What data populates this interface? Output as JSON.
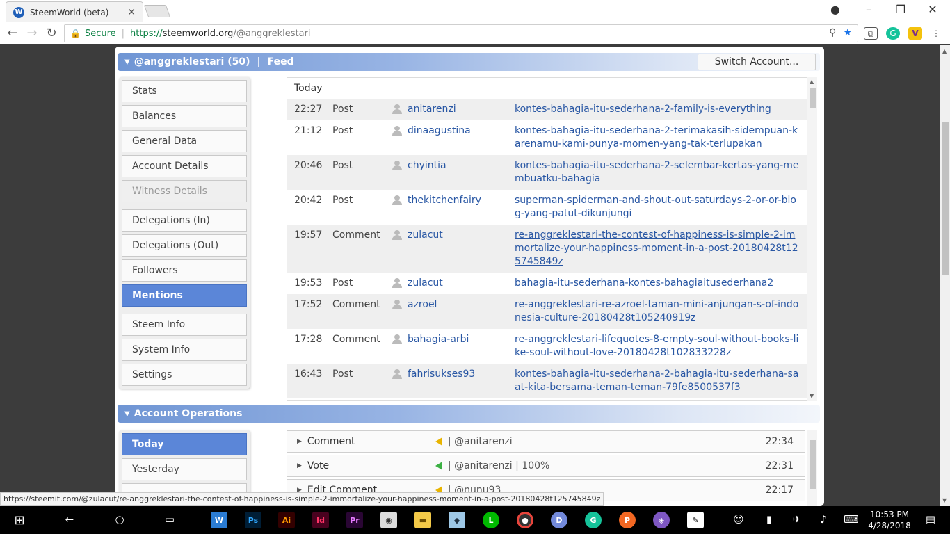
{
  "browser": {
    "tab_title": "SteemWorld (beta)",
    "tab_close": "✕",
    "secure_label": "Secure",
    "url_scheme": "https://",
    "url_host": "steemworld.org",
    "url_path": "/@anggreklestari",
    "status_url": "https://steemit.com/@zulacut/re-anggreklestari-the-contest-of-happiness-is-simple-2-immortalize-your-happiness-moment-in-a-post-20180428t125745849z"
  },
  "feed_section": {
    "account": "@anggreklestari (50)",
    "separator": "|",
    "title": "Feed",
    "switch_label": "Switch Account..."
  },
  "menu": {
    "items": [
      "Stats",
      "Balances",
      "General Data",
      "Account Details",
      "Witness Details"
    ],
    "items2": [
      "Delegations (In)",
      "Delegations (Out)",
      "Followers",
      "Mentions"
    ],
    "items3": [
      "Steem Info",
      "System Info",
      "Settings"
    ],
    "active": "Mentions"
  },
  "feed": {
    "group_label": "Today",
    "rows": [
      {
        "time": "22:27",
        "type": "Post",
        "user": "anitarenzi",
        "link": "kontes-bahagia-itu-sederhana-2-family-is-everything"
      },
      {
        "time": "21:12",
        "type": "Post",
        "user": "dinaagustina",
        "link": "kontes-bahagia-itu-sederhana-2-terimakasih-sidempuan-karenamu-kami-punya-momen-yang-tak-terlupakan"
      },
      {
        "time": "20:46",
        "type": "Post",
        "user": "chyintia",
        "link": "kontes-bahagia-itu-sederhana-2-selembar-kertas-yang-membuatku-bahagia"
      },
      {
        "time": "20:42",
        "type": "Post",
        "user": "thekitchenfairy",
        "link": "superman-spiderman-and-shout-out-saturdays-2-or-or-blog-yang-patut-dikunjungi"
      },
      {
        "time": "19:57",
        "type": "Comment",
        "user": "zulacut",
        "link": "re-anggreklestari-the-contest-of-happiness-is-simple-2-immortalize-your-happiness-moment-in-a-post-20180428t125745849z"
      },
      {
        "time": "19:53",
        "type": "Post",
        "user": "zulacut",
        "link": "bahagia-itu-sederhana-kontes-bahagiaitusederhana2"
      },
      {
        "time": "17:52",
        "type": "Comment",
        "user": "azroel",
        "link": "re-anggreklestari-re-azroel-taman-mini-anjungan-s-of-indonesia-culture-20180428t105240919z"
      },
      {
        "time": "17:28",
        "type": "Comment",
        "user": "bahagia-arbi",
        "link": "re-anggreklestari-lifequotes-8-empty-soul-without-books-like-soul-without-love-20180428t102833228z"
      },
      {
        "time": "16:43",
        "type": "Post",
        "user": "fahrisukses93",
        "link": "kontes-bahagia-itu-sederhana-2-bahagia-itu-sederhana-saat-kita-bersama-teman-teman-79fe8500537f3"
      }
    ]
  },
  "ops_section": {
    "title": "Account Operations",
    "menu": [
      "Today",
      "Yesterday"
    ],
    "active": "Today",
    "rows": [
      {
        "name": "Comment",
        "detail": "| @anitarenzi",
        "time": "22:34",
        "flag": "yellow"
      },
      {
        "name": "Vote",
        "detail": "| @anitarenzi | 100%",
        "time": "22:31",
        "flag": "green"
      },
      {
        "name": "Edit Comment",
        "detail": "| @nunu93",
        "time": "22:17",
        "flag": "yellow"
      }
    ]
  },
  "taskbar": {
    "clock_time": "10:53 PM",
    "clock_date": "4/28/2018"
  },
  "colors": {
    "accent": "#5b86d8",
    "link": "#2957a4",
    "secure_green": "#0b8043"
  }
}
